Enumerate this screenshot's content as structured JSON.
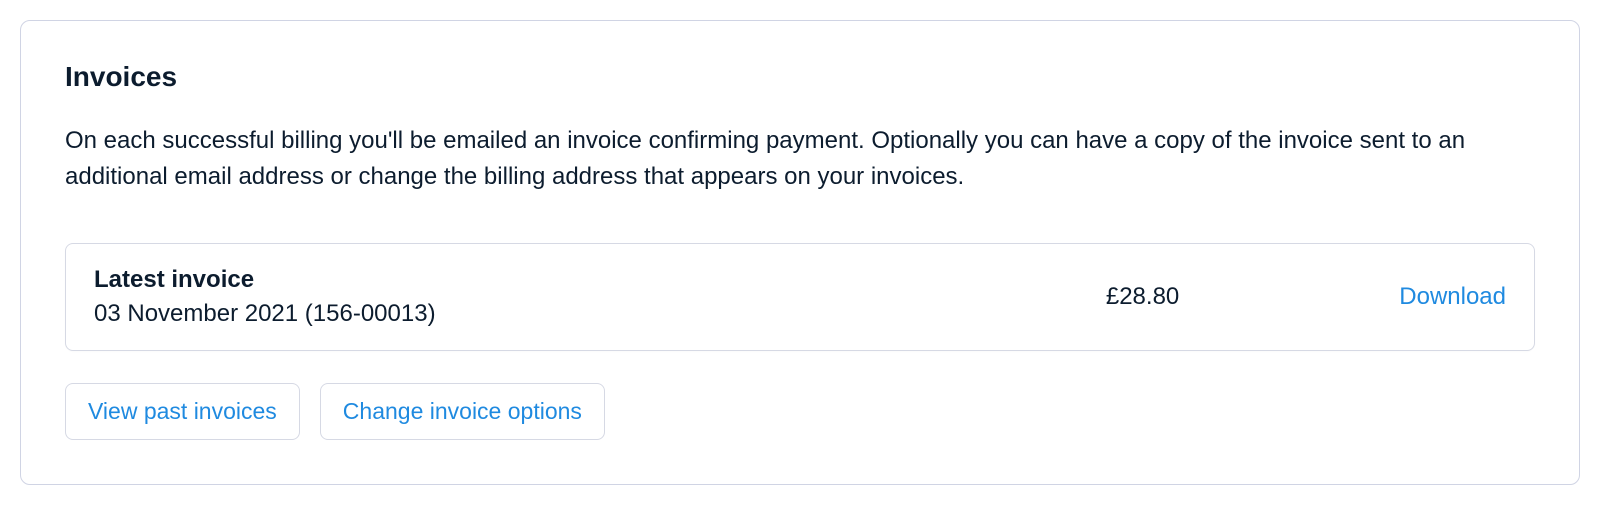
{
  "panel": {
    "title": "Invoices",
    "description": "On each successful billing you'll be emailed an invoice confirming payment. Optionally you can have a copy of the invoice sent to an additional email address or change the billing address that appears on your invoices."
  },
  "invoice": {
    "heading": "Latest invoice",
    "subline": "03 November 2021 (156-00013)",
    "amount": "£28.80",
    "download_label": "Download"
  },
  "buttons": {
    "view_past": "View past invoices",
    "change_options": "Change invoice options"
  }
}
